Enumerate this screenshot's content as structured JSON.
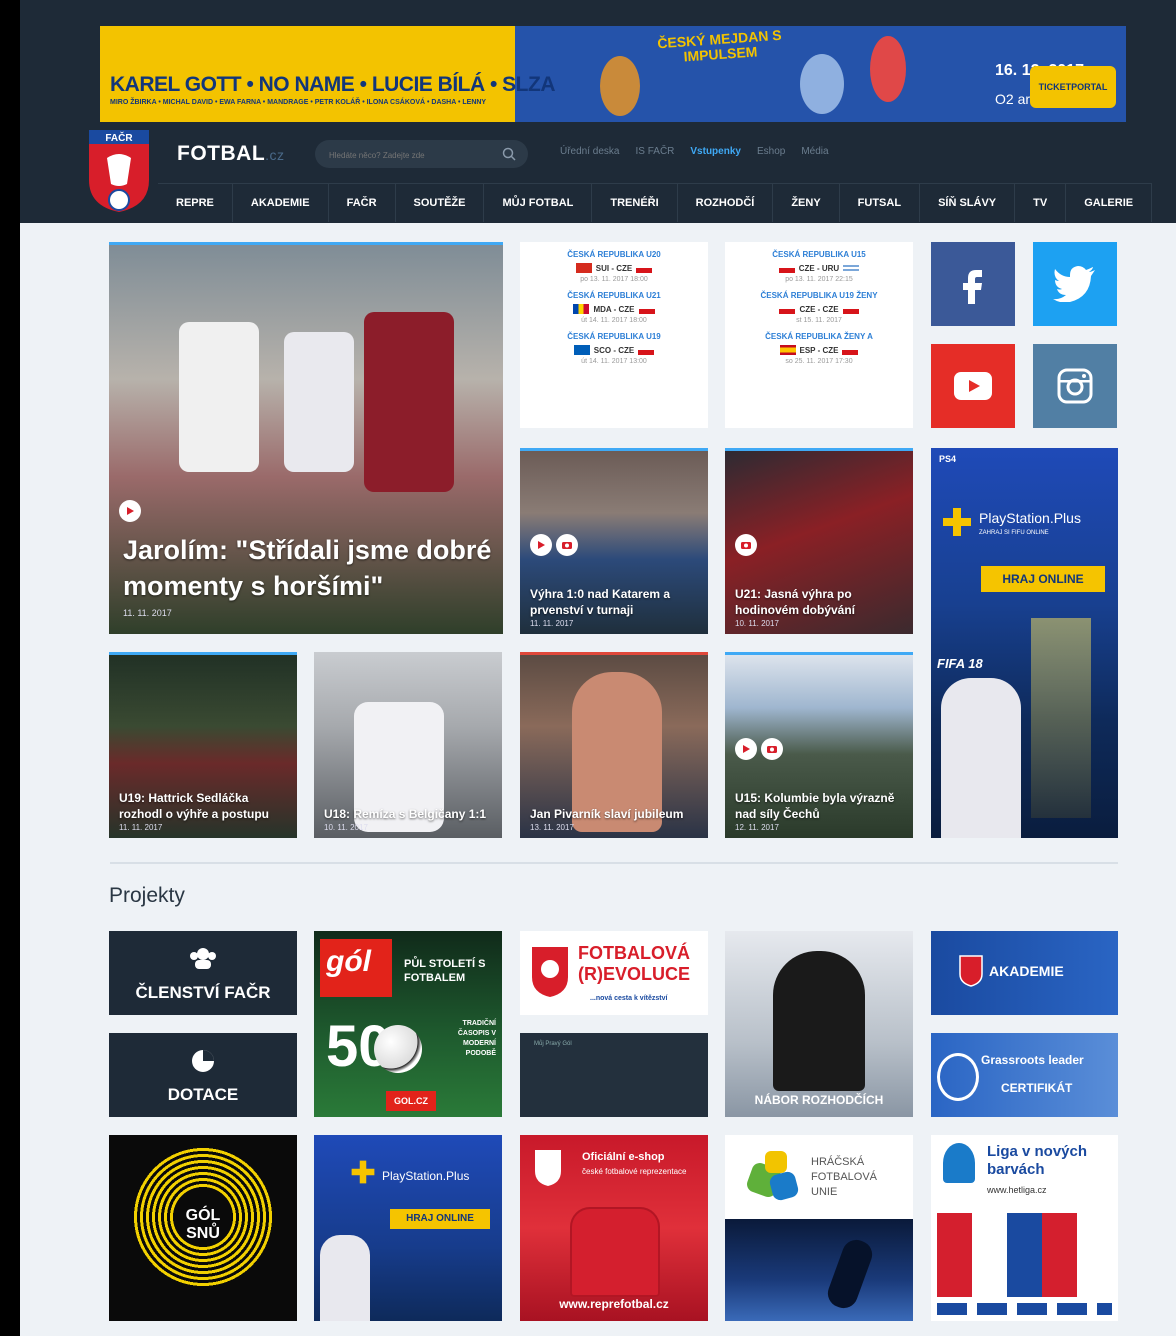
{
  "banner": {
    "artists": "KAREL GOTT • NO NAME • LUCIE BÍLÁ • SLZA",
    "guests": "MIRO ŽBIRKA • MICHAL DAVID • EWA FARNA • MANDRAGE • PETR KOLÁŘ • ILONA CSÁKOVÁ • DASHA • LENNY",
    "show": "ČESKÝ MEJDAN S IMPULSEM",
    "date": "16. 12. 2017",
    "venue": "O2 arena"
  },
  "site": {
    "name": "FOTBAL",
    "suffix": ".cz"
  },
  "search": {
    "placeholder": "Hledáte něco? Zadejte zde"
  },
  "toplinks": [
    "Úřední deska",
    "IS FAČR",
    "Vstupenky",
    "Eshop",
    "Média"
  ],
  "nav": [
    "REPRE",
    "AKADEMIE",
    "FAČR",
    "SOUTĚŽE",
    "MŮJ FOTBAL",
    "TRENÉŘI",
    "ROZHODČÍ",
    "ŽENY",
    "FUTSAL",
    "SÍŇ SLÁVY",
    "TV",
    "GALERIE"
  ],
  "main_article": {
    "title": "Jarolím: \"Střídali jsme dobré momenty s horšími\"",
    "date": "11. 11. 2017"
  },
  "matches_left": [
    {
      "team": "ČESKÁ REPUBLIKA U20",
      "score": "SUI - CZE",
      "when": "po 13. 11. 2017 18:00"
    },
    {
      "team": "ČESKÁ REPUBLIKA U21",
      "score": "MDA - CZE",
      "when": "út 14. 11. 2017 18:00"
    },
    {
      "team": "ČESKÁ REPUBLIKA U19",
      "score": "SCO - CZE",
      "when": "út 14. 11. 2017 13:00"
    }
  ],
  "matches_right": [
    {
      "team": "ČESKÁ REPUBLIKA U15",
      "score": "CZE - URU",
      "when": "po 13. 11. 2017 22:15"
    },
    {
      "team": "ČESKÁ REPUBLIKA U19 ŽENY",
      "score": "CZE - CZE",
      "when": "st 15. 11. 2017"
    },
    {
      "team": "ČESKÁ REPUBLIKA ŽENY A",
      "score": "ESP - CZE",
      "when": "so 25. 11. 2017 17:30"
    }
  ],
  "articles": [
    {
      "title": "Výhra 1:0 nad Katarem a prvenství v turnaji",
      "date": "11. 11. 2017"
    },
    {
      "title": "U21: Jasná výhra po hodinovém dobývání",
      "date": "10. 11. 2017"
    },
    {
      "title": "U19: Hattrick Sedláčka rozhodl o výhře a postupu",
      "date": "11. 11. 2017"
    },
    {
      "title": "U18: Remíza s Belgičany 1:1",
      "date": "10. 11. 2017"
    },
    {
      "title": "Jan Pivarník slaví jubileum",
      "date": "13. 11. 2017"
    },
    {
      "title": "U15: Kolumbie byla výrazně nad síly Čechů",
      "date": "12. 11. 2017"
    }
  ],
  "ad_ps": {
    "brand": "PlayStation.Plus",
    "sub": "ZAHRAJ SI FIFU ONLINE",
    "cta": "HRAJ ONLINE",
    "game": "FIFA 18"
  },
  "projects": {
    "title": "Projekty",
    "clenstvi": "ČLENSTVÍ FAČR",
    "dotace": "DOTACE",
    "gol_title": "PŮL STOLETÍ S FOTBALEM",
    "gol_num": "50",
    "gol_sub": "TRADIČNÍ ČASOPIS V MODERNÍ PODOBĚ",
    "gol_url": "GOL.CZ",
    "gol_logo": "gól",
    "revoluce": "FOTBALOVÁ (R)EVOLUCE",
    "revoluce_sub": "...nová cesta k vítězství",
    "mujfotbal": "Můj Pravý Gól",
    "nabor": "NÁBOR ROZHODČÍCH",
    "akademie": "AKADEMIE",
    "grassroots1": "Grassroots leader",
    "grassroots2": "CERTIFIKÁT",
    "golsnu": "GÓL SNŮ",
    "ps2_brand": "PlayStation.Plus",
    "ps2_cta": "HRAJ ONLINE",
    "eshop1": "Oficiální e-shop",
    "eshop2": "české fotbalové reprezentace",
    "eshop_url": "www.reprefotbal.cz",
    "unie": "HRÁČSKÁ FOTBALOVÁ UNIE",
    "liga1": "Liga v nových barvách",
    "liga2": "www.hetliga.cz"
  },
  "colors": {
    "header": "#1e2a37",
    "accent": "#3fa9f5",
    "facebook": "#3b5998",
    "twitter": "#1da1f2",
    "youtube": "#e52d27",
    "instagram": "#517fa4"
  }
}
